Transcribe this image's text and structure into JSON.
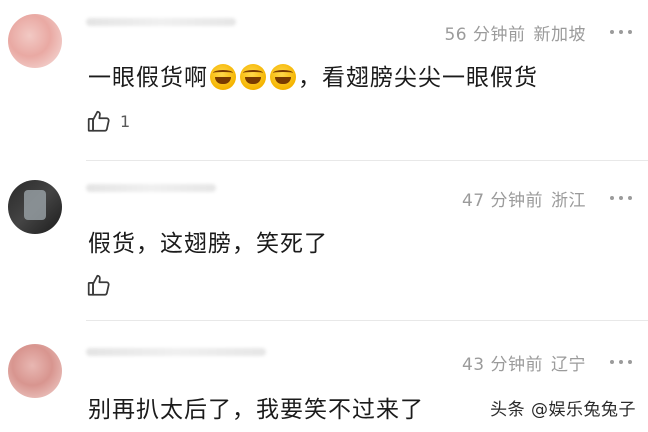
{
  "comments": [
    {
      "time": "56 分钟前",
      "location": "新加坡",
      "text_before": "一眼假货啊",
      "emoji": [
        "rolling-on-floor-laughing-emoji",
        "rolling-on-floor-laughing-emoji",
        "rolling-on-floor-laughing-emoji"
      ],
      "text_after": "，看翅膀尖尖一眼假货",
      "likes": "1"
    },
    {
      "time": "47 分钟前",
      "location": "浙江",
      "text": "假货，这翅膀，笑死了",
      "likes": ""
    },
    {
      "time": "43 分钟前",
      "location": "辽宁",
      "text": "别再扒太后了，我要笑不过来了"
    }
  ],
  "watermark": "头条 @娱乐兔兔子"
}
